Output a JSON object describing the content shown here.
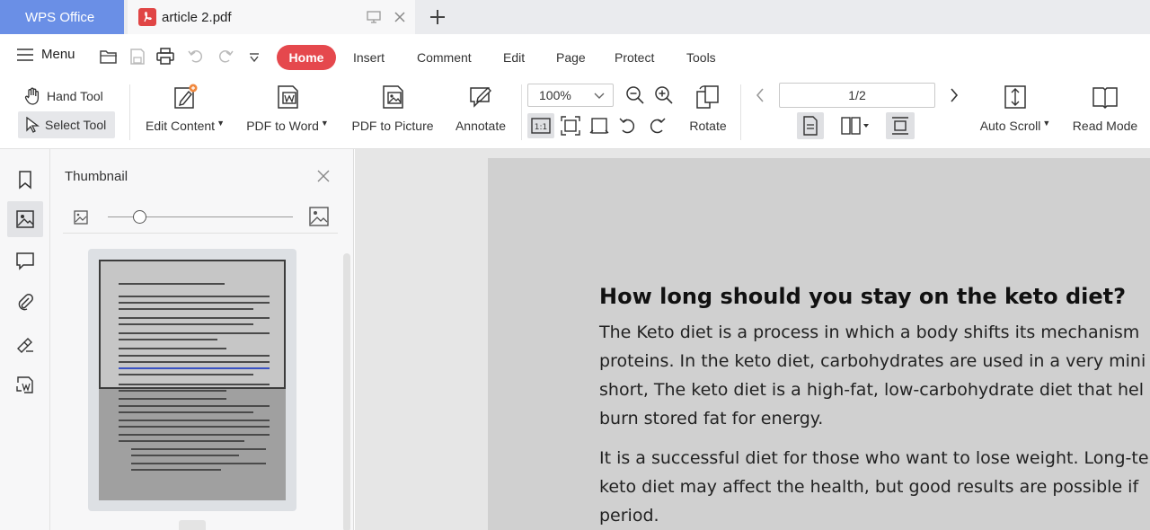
{
  "tabs": {
    "app_label": "WPS Office",
    "document_label": "article 2.pdf"
  },
  "menu": {
    "menu_label": "Menu",
    "ribbon_tabs": [
      "Home",
      "Insert",
      "Comment",
      "Edit",
      "Page",
      "Protect",
      "Tools"
    ],
    "active_tab": "Home"
  },
  "toolbar": {
    "hand_tool": "Hand Tool",
    "select_tool": "Select Tool",
    "edit_content": "Edit Content",
    "pdf_to_word": "PDF to Word",
    "pdf_to_picture": "PDF to Picture",
    "annotate": "Annotate",
    "zoom_value": "100%",
    "rotate": "Rotate",
    "page_indicator": "1/2",
    "auto_scroll": "Auto Scroll",
    "read_mode": "Read Mode"
  },
  "thumbnail_panel": {
    "title": "Thumbnail",
    "zoom_slider_level": 0.17
  },
  "document": {
    "heading": "How long should you stay on the keto diet?",
    "paragraph1": [
      "The Keto diet is a process in which a body shifts its mechanism",
      "proteins. In the keto diet, carbohydrates are used in a very mini",
      "short, The keto diet is a high-fat, low-carbohydrate diet that hel",
      "burn stored fat for energy."
    ],
    "paragraph2": [
      "It is a successful diet for those who want to lose weight. Long-te",
      "keto diet may affect the health, but good results are possible if",
      "period."
    ]
  },
  "colors": {
    "app_tab": "#6a8fe6",
    "home_tab": "#e5484d",
    "pdf_badge": "#e04545"
  }
}
